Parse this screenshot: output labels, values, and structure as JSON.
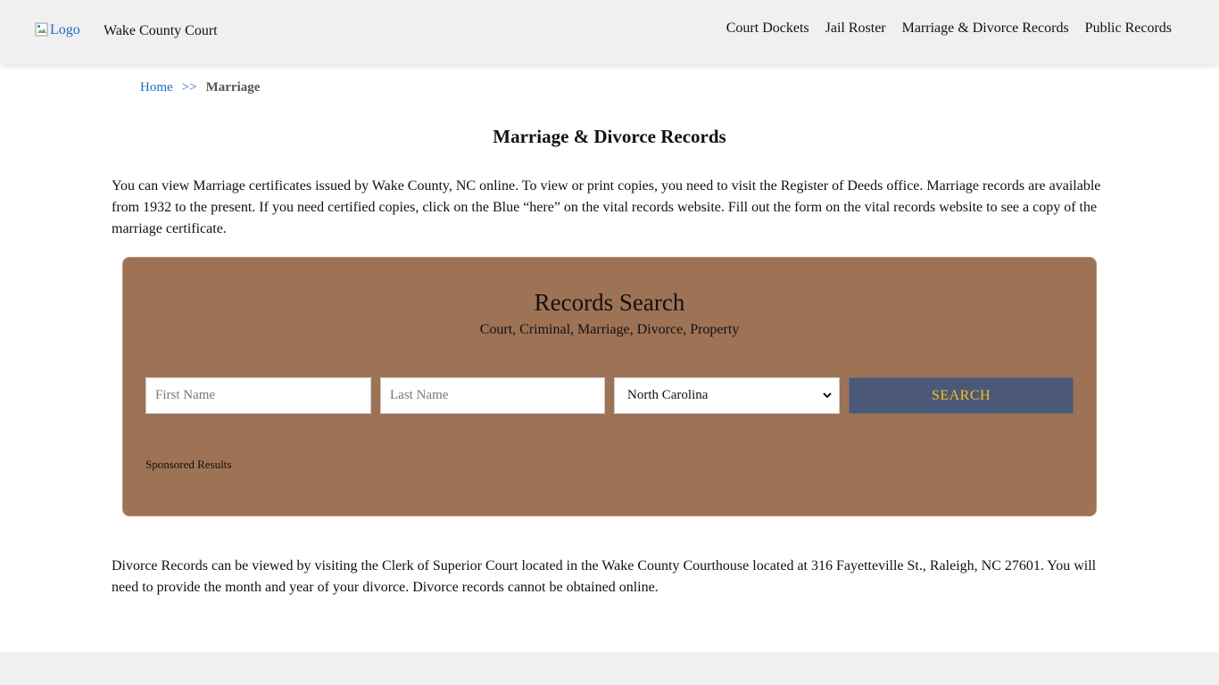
{
  "header": {
    "logo_alt": "Logo",
    "site_title": "Wake County Court",
    "nav": [
      {
        "label": "Court Dockets"
      },
      {
        "label": "Jail Roster"
      },
      {
        "label": "Marriage & Divorce Records"
      },
      {
        "label": "Public Records"
      }
    ]
  },
  "breadcrumb": {
    "home": "Home",
    "separator": ">>",
    "current": "Marriage"
  },
  "main": {
    "title": "Marriage & Divorce Records",
    "intro": "You can view Marriage certificates issued by Wake County, NC online. To view or print copies, you need to visit the Register of Deeds office. Marriage records are available from 1932 to the present. If you need certified copies, click on the Blue “here” on the vital records website. Fill out the form on the vital records website to see a copy of the marriage certificate.",
    "divorce_text": "Divorce Records can be viewed by visiting the Clerk of Superior Court located in the Wake County Courthouse located at 316 Fayetteville St., Raleigh, NC 27601. You will need to provide the month and year of your divorce. Divorce records cannot be obtained online."
  },
  "search": {
    "title": "Records Search",
    "subtitle": "Court, Criminal, Marriage, Divorce, Property",
    "first_name_placeholder": "First Name",
    "last_name_placeholder": "Last Name",
    "state_selected": "North Carolina",
    "button_label": "SEARCH",
    "sponsored": "Sponsored Results"
  },
  "colors": {
    "search_panel_bg": "#9e7255",
    "search_button_bg": "#4b5878",
    "search_button_text": "#f2c21e",
    "link": "#1a6fc4"
  }
}
